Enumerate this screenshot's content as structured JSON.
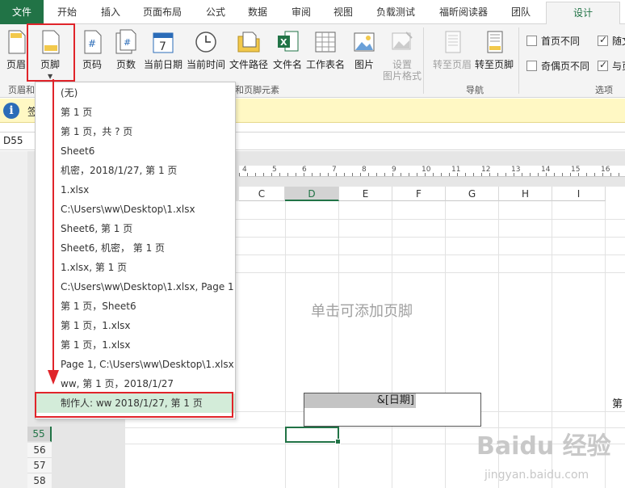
{
  "tabs": [
    "文件",
    "开始",
    "插入",
    "页面布局",
    "公式",
    "数据",
    "审阅",
    "视图",
    "负载测试",
    "福昕阅读器",
    "团队",
    "设计"
  ],
  "ribbon": {
    "buttons": {
      "header": "页眉",
      "footer": "页脚",
      "page_number": "页码",
      "page_count": "页数",
      "current_date": "当前日期",
      "current_time": "当前时间",
      "file_path": "文件路径",
      "file_name": "文件名",
      "sheet_name": "工作表名",
      "picture": "图片",
      "format_picture_l1": "设置",
      "format_picture_l2": "图片格式",
      "goto_header": "转至页眉",
      "goto_footer": "转至页脚"
    },
    "groups": {
      "header_footer": "页眉和",
      "elements": "和页脚元素",
      "navigation": "导航",
      "options": "选项"
    },
    "options": {
      "first_page_diff": "首页不同",
      "odd_even_diff": "奇偶页不同",
      "scale_with_doc": "随文",
      "align_margins": "与页",
      "first_page_checked": false,
      "odd_even_checked": false,
      "scale_checked": true,
      "align_checked": true
    }
  },
  "infobar": {
    "text": "签"
  },
  "namebox": "D55",
  "ruler": [
    "4",
    "5",
    "6",
    "7",
    "8",
    "9",
    "10",
    "11",
    "12",
    "13",
    "14",
    "15",
    "16"
  ],
  "columns": [
    "C",
    "D",
    "E",
    "F",
    "G",
    "H",
    "I"
  ],
  "footer_placeholder": "单击可添加页脚",
  "footer_center": "&[日期]",
  "footer_right": "第",
  "rows": [
    "55",
    "56",
    "57",
    "58"
  ],
  "dropdown": [
    "(无)",
    "第 1 页",
    "第 1 页，共 ? 页",
    "Sheet6",
    " 机密，2018/1/27,  第 1 页",
    "1.xlsx",
    "C:\\Users\\ww\\Desktop\\1.xlsx",
    "Sheet6, 第 1 页",
    "Sheet6,  机密，  第 1 页",
    "1.xlsx,  第 1 页",
    "C:\\Users\\ww\\Desktop\\1.xlsx, Page 1",
    "第 1 页，Sheet6",
    "第 1 页，1.xlsx",
    "第 1 页，1.xlsx",
    "Page 1, C:\\Users\\ww\\Desktop\\1.xlsx",
    "ww,  第 1 页，2018/1/27",
    "制作人: ww 2018/1/27,  第 1 页"
  ],
  "watermark": "Baidu 经验",
  "watermark_url": "jingyan.baidu.com",
  "colors": {
    "excel_green": "#217346",
    "annotation_red": "#e0242a",
    "highlight": "#d3ecd9"
  }
}
